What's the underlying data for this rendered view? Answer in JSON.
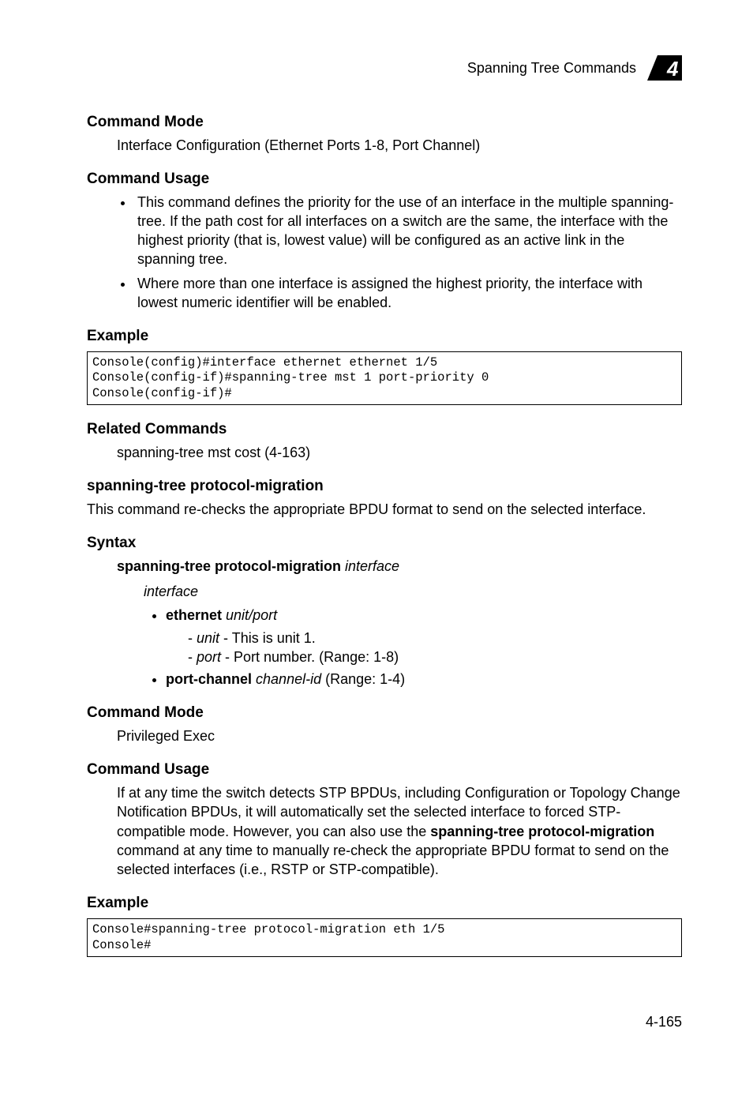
{
  "header": {
    "running_title": "Spanning Tree Commands",
    "chapter_number": "4"
  },
  "s1": {
    "title": "Command Mode",
    "text": "Interface Configuration (Ethernet Ports 1-8, Port Channel)"
  },
  "s2": {
    "title": "Command Usage",
    "bullets": [
      "This command defines the priority for the use of an interface in the multiple spanning-tree. If the path cost for all interfaces on a switch are the same, the interface with the highest priority (that is, lowest value) will be configured as an active link in the spanning tree.",
      "Where more than one interface is assigned the highest priority, the interface with lowest numeric identifier will be enabled."
    ]
  },
  "s3": {
    "title": "Example",
    "code": "Console(config)#interface ethernet ethernet 1/5\nConsole(config-if)#spanning-tree mst 1 port-priority 0\nConsole(config-if)#"
  },
  "s4": {
    "title": "Related Commands",
    "text": "spanning-tree mst cost (4-163)"
  },
  "cmd": {
    "name": "spanning-tree protocol-migration",
    "desc": "This command re-checks the appropriate BPDU format to send on the selected interface."
  },
  "s5": {
    "title": "Syntax",
    "literal": "spanning-tree protocol-migration",
    "arg": "interface",
    "arg_label": "interface",
    "eth_literal": "ethernet",
    "eth_arg1": "unit",
    "eth_sep": "/",
    "eth_arg2": "port",
    "unit_arg": "unit",
    "unit_desc": " - This is unit 1.",
    "port_arg": "port",
    "port_desc": " - Port number. (Range: 1-8)",
    "pc_literal": "port-channel",
    "pc_arg": "channel-id",
    "pc_desc": " (Range: 1-4)"
  },
  "s6": {
    "title": "Command Mode",
    "text": "Privileged Exec"
  },
  "s7": {
    "title": "Command Usage",
    "pre": "If at any time the switch detects STP BPDUs, including Configuration or Topology Change Notification BPDUs, it will automatically set the selected interface to forced STP-compatible mode. However, you can also use the ",
    "bold": "spanning-tree protocol-migration",
    "post": " command at any time to manually re-check the appropriate BPDU format to send on the selected interfaces (i.e., RSTP or STP-compatible)."
  },
  "s8": {
    "title": "Example",
    "code": "Console#spanning-tree protocol-migration eth 1/5\nConsole#"
  },
  "footer": {
    "page": "4-165"
  }
}
